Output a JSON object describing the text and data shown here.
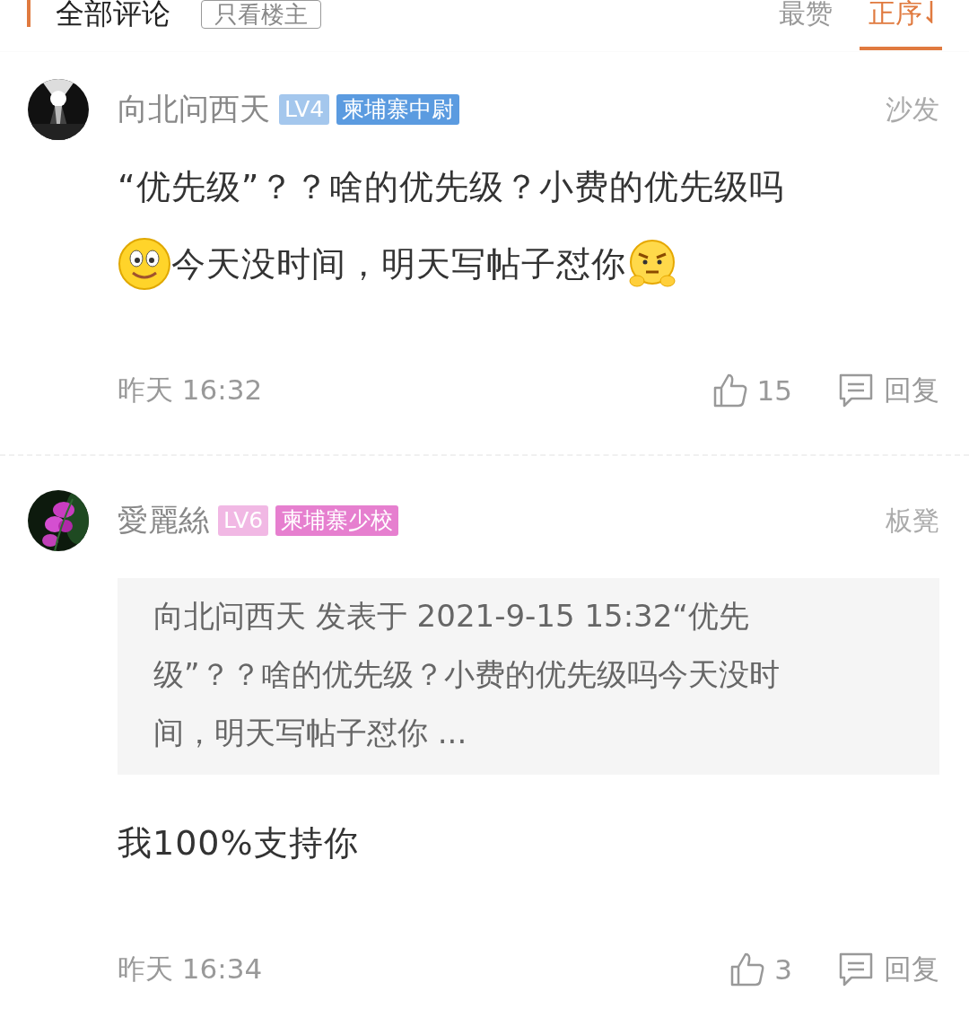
{
  "header": {
    "title": "全部评论",
    "filter_button": "只看楼主",
    "sort_tabs": [
      {
        "label": "最赞",
        "selected": false
      },
      {
        "label": "正序",
        "selected": true
      }
    ]
  },
  "comments": [
    {
      "author": "向北问西天",
      "level": "LV4",
      "rank": "柬埔寨中尉",
      "color": "#5b9be0",
      "floor": "沙发",
      "avatar": {
        "kind": "picture"
      },
      "lines": [
        [
          {
            "kind": "text",
            "text": "“优先级”？？啥的优先级？小费的优先级吗"
          }
        ],
        [
          {
            "kind": "smiley"
          },
          {
            "kind": "text",
            "text": "今天没时间，明天写帖子怼你"
          },
          {
            "kind": "grumpy"
          }
        ]
      ],
      "time": "昨天 16:32",
      "likes": "15",
      "reply": "回复"
    },
    {
      "author": "愛麗絲",
      "level": "LV6",
      "rank": "柬埔寨少校",
      "color": "#e67fcf",
      "floor": "板凳",
      "avatar": {
        "kind": "picture"
      },
      "quote": "向北问西天 发表于 2021-9-15 15:32“优先级”？？啥的优先级？小费的优先级吗今天没时间，明天写帖子怼你 ...",
      "lines": [
        [
          {
            "kind": "text",
            "text": "我100%支持你"
          }
        ]
      ],
      "time": "昨天 16:34",
      "likes": "3",
      "reply": "回复"
    }
  ]
}
